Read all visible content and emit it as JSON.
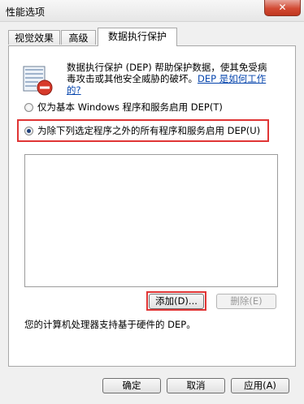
{
  "window": {
    "title": "性能选项",
    "close_glyph": "✕"
  },
  "tabs": [
    {
      "label": "视觉效果"
    },
    {
      "label": "高级"
    },
    {
      "label": "数据执行保护"
    }
  ],
  "dep": {
    "description_line1": "数据执行保护 (DEP) 帮助保护数据，使其免受病",
    "description_line2": "毒攻击或其他安全威胁的破坏。",
    "link_part1": "DEP 是如何工作",
    "link_part2": "的?"
  },
  "options": [
    {
      "label": "仅为基本 Windows 程序和服务启用 DEP(T)",
      "checked": false
    },
    {
      "label": "为除下列选定程序之外的所有程序和服务启用 DEP(U)",
      "checked": true
    }
  ],
  "buttons": {
    "add": "添加(D)...",
    "remove": "删除(E)",
    "ok": "确定",
    "cancel": "取消",
    "apply": "应用(A)"
  },
  "footer": {
    "hardware_support": "您的计算机处理器支持基于硬件的 DEP。"
  },
  "colors": {
    "highlight": "#e03535",
    "link": "#0645ad"
  },
  "icons": {
    "dep": "dep-shield-icon",
    "close": "close-icon"
  }
}
